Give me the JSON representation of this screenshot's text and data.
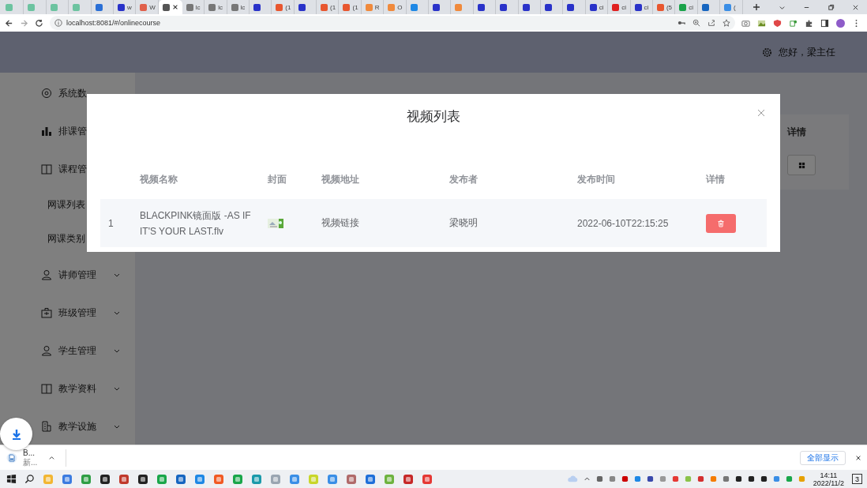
{
  "browser": {
    "tabs": [
      {
        "selected": false,
        "color": "#6cc3a0"
      },
      {
        "selected": false,
        "color": "#6cc3a0"
      },
      {
        "selected": false,
        "color": "#6cc3a0"
      },
      {
        "selected": false,
        "color": "#6cc3a0"
      },
      {
        "selected": false,
        "color": "#2a6fd6"
      },
      {
        "label": "w",
        "selected": false,
        "color": "#2932c9"
      },
      {
        "label": "W",
        "selected": false,
        "color": "#e0604a"
      },
      {
        "selected": true,
        "color": "#555555"
      },
      {
        "label": "lc",
        "selected": false,
        "color": "#777777"
      },
      {
        "label": "lc",
        "selected": false,
        "color": "#777777"
      },
      {
        "label": "lc",
        "selected": false,
        "color": "#777777"
      },
      {
        "selected": false,
        "color": "#2932c9"
      },
      {
        "label": "(1",
        "selected": false,
        "color": "#e8562f"
      },
      {
        "selected": false,
        "color": "#2932c9"
      },
      {
        "label": "(1",
        "selected": false,
        "color": "#e8562f"
      },
      {
        "label": "(1",
        "selected": false,
        "color": "#e8562f"
      },
      {
        "label": "R",
        "selected": false,
        "color": "#f08a3c"
      },
      {
        "label": "O",
        "selected": false,
        "color": "#f08a3c"
      },
      {
        "selected": false,
        "color": "#1e88e5"
      },
      {
        "selected": false,
        "color": "#2932c9"
      },
      {
        "selected": false,
        "color": "#f08a3c"
      },
      {
        "selected": false,
        "color": "#2932c9"
      },
      {
        "selected": false,
        "color": "#2932c9"
      },
      {
        "selected": false,
        "color": "#2932c9"
      },
      {
        "selected": false,
        "color": "#2932c9"
      },
      {
        "selected": false,
        "color": "#2932c9"
      },
      {
        "label": "ci",
        "selected": false,
        "color": "#2932c9"
      },
      {
        "label": "ci",
        "selected": false,
        "color": "#e02020"
      },
      {
        "label": "ci",
        "selected": false,
        "color": "#2932c9"
      },
      {
        "label": "(5",
        "selected": false,
        "color": "#e8562f"
      },
      {
        "label": "ci",
        "selected": false,
        "color": "#1aa34a"
      },
      {
        "selected": false,
        "color": "#1565c0"
      },
      {
        "label": "(",
        "selected": false,
        "color": "#3a8ee6"
      }
    ],
    "address": "localhost:8081/#/onlinecourse"
  },
  "header": {
    "greeting": "您好，梁主任"
  },
  "sidebar": {
    "items": [
      {
        "label": "系统数",
        "kind": "heading"
      },
      {
        "label": "排课管",
        "kind": "heading"
      },
      {
        "label": "课程管",
        "kind": "heading"
      },
      {
        "label": "网课列表",
        "kind": "sub"
      },
      {
        "label": "网课类别",
        "kind": "sub"
      },
      {
        "label": "讲师管理",
        "kind": "group"
      },
      {
        "label": "班级管理",
        "kind": "group"
      },
      {
        "label": "学生管理",
        "kind": "group"
      },
      {
        "label": "教学资料",
        "kind": "group"
      },
      {
        "label": "教学设施",
        "kind": "group"
      }
    ]
  },
  "background_table": {
    "column": "详情"
  },
  "dialog": {
    "title": "视频列表",
    "columns": [
      "",
      "视频名称",
      "封面",
      "视频地址",
      "发布者",
      "发布时间",
      "详情"
    ],
    "rows": [
      {
        "index": "1",
        "name": "BLACKPINK镜面版 -AS IF IT'S YOUR LAST.flv",
        "address": "视频链接",
        "publisher": "梁晓明",
        "time": "2022-06-10T22:15:25"
      }
    ]
  },
  "download_bar": {
    "file": "B...",
    "status": "新...",
    "show_all": "全部显示"
  },
  "taskbar": {
    "time": "14:11",
    "date": "2022/11/2",
    "notifications": "3"
  }
}
